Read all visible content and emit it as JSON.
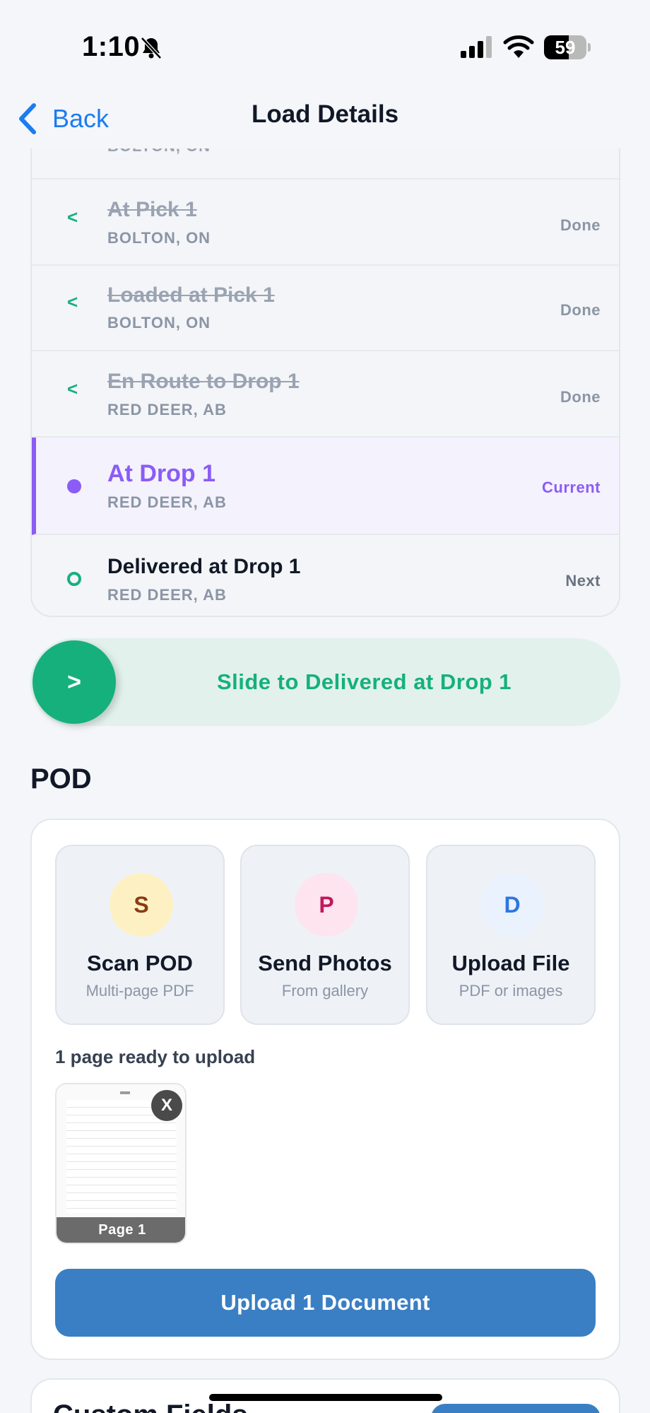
{
  "status_bar": {
    "time": "1:10",
    "battery_percent": "59",
    "battery_level": 0.59,
    "icons": [
      "bell-slash-icon",
      "cellular-signal-icon",
      "wifi-icon",
      "battery-icon"
    ]
  },
  "nav": {
    "back_label": "Back",
    "title": "Load Details",
    "accent_color": "#1a7cf2"
  },
  "timeline": {
    "partial_sub": "BOLTON, ON",
    "stops": [
      {
        "title": "At Pick 1",
        "location": "BOLTON, ON",
        "state": "Done",
        "marker": "<"
      },
      {
        "title": "Loaded at Pick 1",
        "location": "BOLTON, ON",
        "state": "Done",
        "marker": "<"
      },
      {
        "title": "En Route to Drop 1",
        "location": "RED DEER, AB",
        "state": "Done",
        "marker": "<"
      },
      {
        "title": "At Drop 1",
        "location": "RED DEER, AB",
        "state": "Current"
      },
      {
        "title": "Delivered at Drop 1",
        "location": "RED DEER, AB",
        "state": "Next"
      }
    ],
    "colors": {
      "done": "#16b07c",
      "current": "#8b5cf6"
    }
  },
  "slider": {
    "knob": ">",
    "label": "Slide to Delivered at Drop 1",
    "color": "#16b07c"
  },
  "pod": {
    "heading": "POD",
    "actions": [
      {
        "badge": "S",
        "label": "Scan POD",
        "desc": "Multi-page PDF",
        "badge_bg": "#fdf1c4",
        "badge_color": "#8a3b12"
      },
      {
        "badge": "P",
        "label": "Send Photos",
        "desc": "From gallery",
        "badge_bg": "#fde4ef",
        "badge_color": "#c2185b"
      },
      {
        "badge": "D",
        "label": "Upload File",
        "desc": "PDF or images",
        "badge_bg": "#eaf2fe",
        "badge_color": "#2f76e0"
      }
    ],
    "ready_text": "1 page ready to upload",
    "thumbnail": {
      "label": "Page 1",
      "close": "X"
    },
    "upload_button": "Upload 1 Document",
    "upload_color": "#3a7fc3"
  },
  "next_section": {
    "title": "Custom Fields"
  }
}
